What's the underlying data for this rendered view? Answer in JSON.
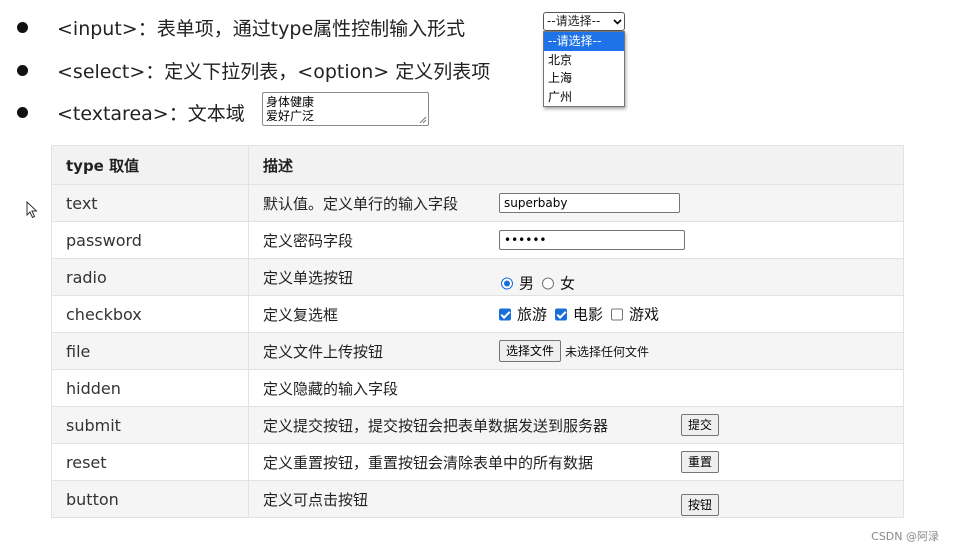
{
  "bullets": [
    {
      "text": "<input>：表单项，通过type属性控制输入形式"
    },
    {
      "text": "<select>：定义下拉列表，<option> 定义列表项"
    },
    {
      "text": "<textarea>：文本域"
    }
  ],
  "textarea_demo": {
    "lines": [
      "身体健康",
      "爱好广泛"
    ]
  },
  "select_demo": {
    "selected": "--请选择--",
    "options": [
      "--请选择--",
      "北京",
      "上海",
      "广州"
    ]
  },
  "table": {
    "headers": [
      "type 取值",
      "描述"
    ],
    "rows": [
      {
        "type": "text",
        "desc": "默认值。定义单行的输入字段",
        "demo_value": "superbaby"
      },
      {
        "type": "password",
        "desc": "定义密码字段",
        "demo_value": "••••••"
      },
      {
        "type": "radio",
        "desc": "定义单选按钮",
        "options": [
          "男",
          "女"
        ]
      },
      {
        "type": "checkbox",
        "desc": "定义复选框",
        "options": [
          "旅游",
          "电影",
          "游戏"
        ]
      },
      {
        "type": "file",
        "desc": "定义文件上传按钮",
        "button": "选择文件",
        "hint": "未选择任何文件"
      },
      {
        "type": "hidden",
        "desc": "定义隐藏的输入字段"
      },
      {
        "type": "submit",
        "desc": "定义提交按钮，提交按钮会把表单数据发送到服务器",
        "button": "提交"
      },
      {
        "type": "reset",
        "desc": "定义重置按钮，重置按钮会清除表单中的所有数据",
        "button": "重置"
      },
      {
        "type": "button",
        "desc": "定义可点击按钮",
        "button": "按钮"
      }
    ]
  },
  "watermark": "CSDN @阿渌",
  "icons": {
    "cursor": "mouse-pointer-icon",
    "chevron": "chevron-down-icon"
  },
  "colors": {
    "accent": "#1e73e8",
    "header_bg": "#f2f2f2",
    "row_alt": "#f5f5f5"
  }
}
